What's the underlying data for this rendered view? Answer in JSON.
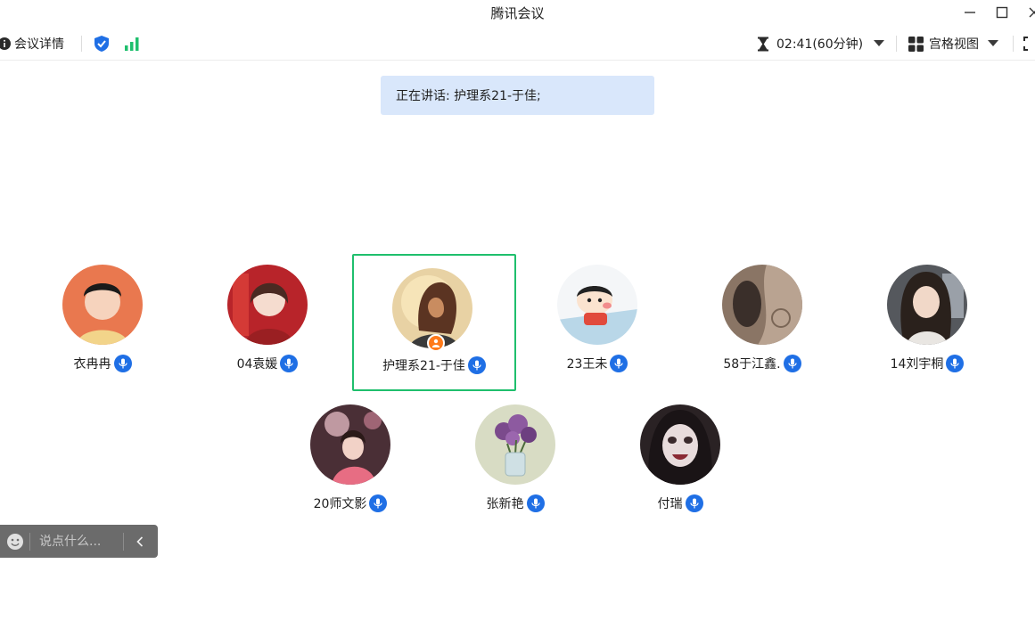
{
  "window": {
    "title": "腾讯会议"
  },
  "toolbar": {
    "meeting_info_label": "会议详情",
    "timer_label": "02:41(60分钟)",
    "view_label": "宫格视图"
  },
  "speaking": {
    "text": "正在讲话: 护理系21-于佳;"
  },
  "participants": [
    {
      "name": "衣冉冉",
      "mic": "mic-icon"
    },
    {
      "name": "04袁媛",
      "mic": "mic-icon"
    },
    {
      "name": "护理系21-于佳",
      "mic": "mic-icon",
      "host": true
    },
    {
      "name": "23王未",
      "mic": "mic-icon"
    },
    {
      "name": "58于江鑫.",
      "mic": "mic-icon"
    },
    {
      "name": "14刘宇桐",
      "mic": "mic-icon"
    },
    {
      "name": "20师文影",
      "mic": "mic-icon"
    },
    {
      "name": "张新艳",
      "mic": "mic-icon"
    },
    {
      "name": "付瑞",
      "mic": "mic-icon"
    }
  ],
  "chat": {
    "placeholder": "说点什么..."
  },
  "colors": {
    "accent": "#1f6fe5",
    "active_border": "#1fbf6d",
    "speaking_bg": "#d9e7fb",
    "host_badge": "#ff7a1a",
    "signal": "#1fbf6d"
  }
}
